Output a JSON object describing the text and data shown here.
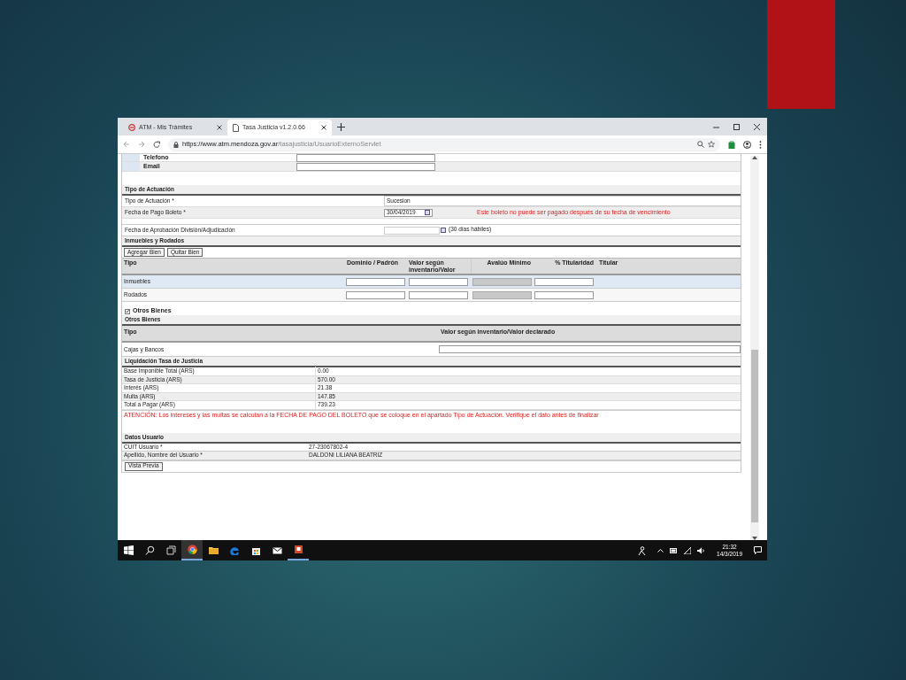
{
  "browser": {
    "tabs": [
      {
        "title": "ATM - Mis Trámites",
        "selected": false
      },
      {
        "title": "Tasa Justicia v1.2.0.66",
        "selected": true
      }
    ],
    "url_host": "https://www.atm.mendoza.gov.ar",
    "url_path": "/tasajusticia/UsuarioExternoServlet"
  },
  "contact_rows": [
    {
      "label": "Telefono"
    },
    {
      "label": "Email"
    }
  ],
  "tipo_actuacion": {
    "title": "Tipo de Actuación",
    "rows": [
      {
        "label": "Tipo de Actuación *",
        "value": "Sucesion"
      },
      {
        "label": "Fecha de Pago Boleto *",
        "value": "30/04/2019",
        "error": "Este boleto no puede ser pagado después de su fecha de vencimiento"
      }
    ],
    "approval": {
      "label": "Fecha de Aprobación División/Adjudicación",
      "note": "(30 días hábiles)"
    }
  },
  "inmuebles": {
    "title": "Inmuebles y Rodados",
    "buttons": [
      "Agregar Bien",
      "Quitar Bien"
    ],
    "columns": [
      "Tipo",
      "Dominio / Padrón",
      "Valor según inventario/Valor",
      "Avalúo Mínimo",
      "% Titularidad",
      "Titular"
    ],
    "rows": [
      {
        "tipo": "Inmuebles",
        "selected": true
      },
      {
        "tipo": "Rodados",
        "selected": false
      }
    ]
  },
  "otros_bienes_checkbox": {
    "label": "Otros Bienes",
    "checked": true
  },
  "otros_bienes": {
    "title": "Otros Bienes",
    "columns": [
      "Tipo",
      "Valor según inventario/Valor declarado"
    ],
    "rows": [
      {
        "tipo": "Cajas y Bancos"
      }
    ]
  },
  "liquidacion": {
    "title": "Liquidación Tasa de Justicia",
    "rows": [
      {
        "label": "Base Imponible Total (ARS)",
        "value": "0.00"
      },
      {
        "label": "Tasa de Justicia (ARS)",
        "value": "570.00"
      },
      {
        "label": "Interés (ARS)",
        "value": "21.38"
      },
      {
        "label": "Multa (ARS)",
        "value": "147.85"
      },
      {
        "label": "Total a Pagar (ARS)",
        "value": "739.23"
      }
    ],
    "warning": "ATENCIÓN: Los intereses y las multas se calculan a la FECHA DE PAGO DEL BOLETO que se coloque en el apartado Tipo de Actuación. Verifique el dato antes de finalizar"
  },
  "datos_usuario": {
    "title": "Datos Usuario",
    "rows": [
      {
        "label": "CUIT Usuario *",
        "value": "27-23067802-4"
      },
      {
        "label": "Apellido, Nombre del Usuario *",
        "value": "DALDONI LILIANA BEATRIZ"
      }
    ]
  },
  "preview_button": "Vista Previa",
  "taskbar": {
    "time": "21:32",
    "date": "14/3/2019"
  }
}
